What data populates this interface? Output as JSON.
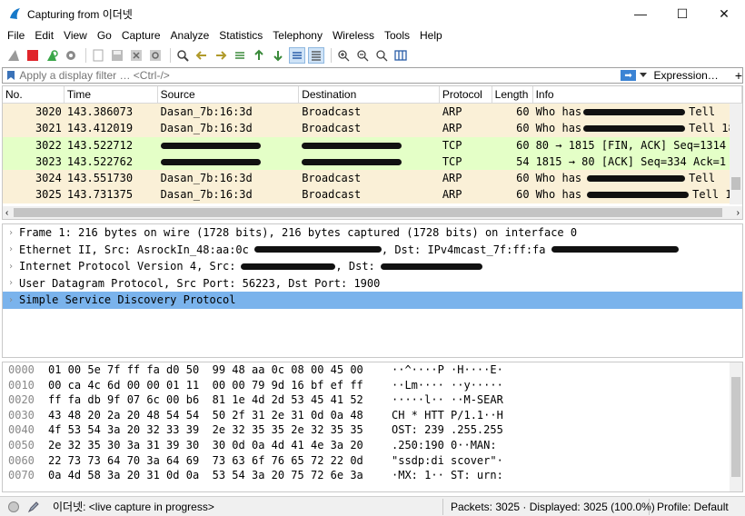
{
  "window": {
    "title": "Capturing from 이더넷",
    "minimize_glyph": "—",
    "maximize_glyph": "☐",
    "close_glyph": "✕"
  },
  "menu": [
    {
      "label": "File"
    },
    {
      "label": "Edit"
    },
    {
      "label": "View"
    },
    {
      "label": "Go"
    },
    {
      "label": "Capture"
    },
    {
      "label": "Analyze"
    },
    {
      "label": "Statistics"
    },
    {
      "label": "Telephony"
    },
    {
      "label": "Wireless"
    },
    {
      "label": "Tools"
    },
    {
      "label": "Help"
    }
  ],
  "filter": {
    "placeholder": "Apply a display filter … <Ctrl-/>",
    "apply_glyph": "➡",
    "expression_label": "Expression…",
    "add_label": "+"
  },
  "packet_columns": [
    "No.",
    "Time",
    "Source",
    "Destination",
    "Protocol",
    "Length",
    "Info"
  ],
  "packets": [
    {
      "no": "3020",
      "time": "143.386073",
      "source": "Dasan_7b:16:3d",
      "destination": "Broadcast",
      "protocol": "ARP",
      "length": "60",
      "info_a": "Who has",
      "info_b": "Tell",
      "bg": "#faf0d7",
      "redact_src": false,
      "redact_dst": false
    },
    {
      "no": "3021",
      "time": "143.412019",
      "source": "Dasan_7b:16:3d",
      "destination": "Broadcast",
      "protocol": "ARP",
      "length": "60",
      "info_a": "Who has",
      "info_b": "Tell 18",
      "bg": "#faf0d7",
      "redact_src": false,
      "redact_dst": false
    },
    {
      "no": "3022",
      "time": "143.522712",
      "source": "",
      "destination": "",
      "protocol": "TCP",
      "length": "60",
      "info_a": "80 → 1815 [FIN, ACK] Seq=1314",
      "info_b": "",
      "bg": "#e4ffc7",
      "redact_src": true,
      "redact_dst": true
    },
    {
      "no": "3023",
      "time": "143.522762",
      "source": "",
      "destination": "",
      "protocol": "TCP",
      "length": "54",
      "info_a": "1815 → 80 [ACK] Seq=334 Ack=1",
      "info_b": "",
      "bg": "#e4ffc7",
      "redact_src": true,
      "redact_dst": true
    },
    {
      "no": "3024",
      "time": "143.551730",
      "source": "Dasan_7b:16:3d",
      "destination": "Broadcast",
      "protocol": "ARP",
      "length": "60",
      "info_a": "Who has",
      "info_b": "Tell",
      "bg": "#faf0d7",
      "redact_src": false,
      "redact_dst": false
    },
    {
      "no": "3025",
      "time": "143.731375",
      "source": "Dasan_7b:16:3d",
      "destination": "Broadcast",
      "protocol": "ARP",
      "length": "60",
      "info_a": "Who has",
      "info_b": "Tell 1",
      "bg": "#faf0d7",
      "redact_src": false,
      "redact_dst": false
    }
  ],
  "details": [
    {
      "text": "Frame 1: 216 bytes on wire (1728 bits), 216 bytes captured (1728 bits) on interface 0",
      "selected": false
    },
    {
      "text": "Ethernet II, Src: AsrockIn_48:aa:0c",
      "tail": ", Dst: IPv4mcast_7f:ff:fa",
      "selected": false
    },
    {
      "text": "Internet Protocol Version 4, Src:",
      "tail": ", Dst:",
      "selected": false
    },
    {
      "text": "User Datagram Protocol, Src Port: 56223, Dst Port: 1900",
      "selected": false
    },
    {
      "text": "Simple Service Discovery Protocol",
      "selected": true
    }
  ],
  "bytes": [
    {
      "offset": "0000",
      "hex": "01 00 5e 7f ff fa d0 50  99 48 aa 0c 08 00 45 00",
      "ascii": "··^····P ·H····E·"
    },
    {
      "offset": "0010",
      "hex": "00 ca 4c 6d 00 00 01 11  00 00 79 9d 16 bf ef ff",
      "ascii": "··Lm···· ··y·····"
    },
    {
      "offset": "0020",
      "hex": "ff fa db 9f 07 6c 00 b6  81 1e 4d 2d 53 45 41 52",
      "ascii": "·····l·· ··M-SEAR"
    },
    {
      "offset": "0030",
      "hex": "43 48 20 2a 20 48 54 54  50 2f 31 2e 31 0d 0a 48",
      "ascii": "CH * HTT P/1.1··H"
    },
    {
      "offset": "0040",
      "hex": "4f 53 54 3a 20 32 33 39  2e 32 35 35 2e 32 35 35",
      "ascii": "OST: 239 .255.255"
    },
    {
      "offset": "0050",
      "hex": "2e 32 35 30 3a 31 39 30  30 0d 0a 4d 41 4e 3a 20",
      "ascii": ".250:190 0··MAN: "
    },
    {
      "offset": "0060",
      "hex": "22 73 73 64 70 3a 64 69  73 63 6f 76 65 72 22 0d",
      "ascii": "\"ssdp:di scover\"·"
    },
    {
      "offset": "0070",
      "hex": "0a 4d 58 3a 20 31 0d 0a  53 54 3a 20 75 72 6e 3a",
      "ascii": "·MX: 1·· ST: urn:"
    }
  ],
  "status": {
    "capture_text": "이더넷: <live capture in progress>",
    "packets_text": "Packets: 3025 · Displayed: 3025 (100.0%)",
    "profile_text": "Profile: Default"
  },
  "colors": {
    "arp_row": "#faf0d7",
    "tcp_row": "#e4ffc7",
    "selected_detail": "#7ab3ec",
    "accent": "#3b83d4"
  }
}
